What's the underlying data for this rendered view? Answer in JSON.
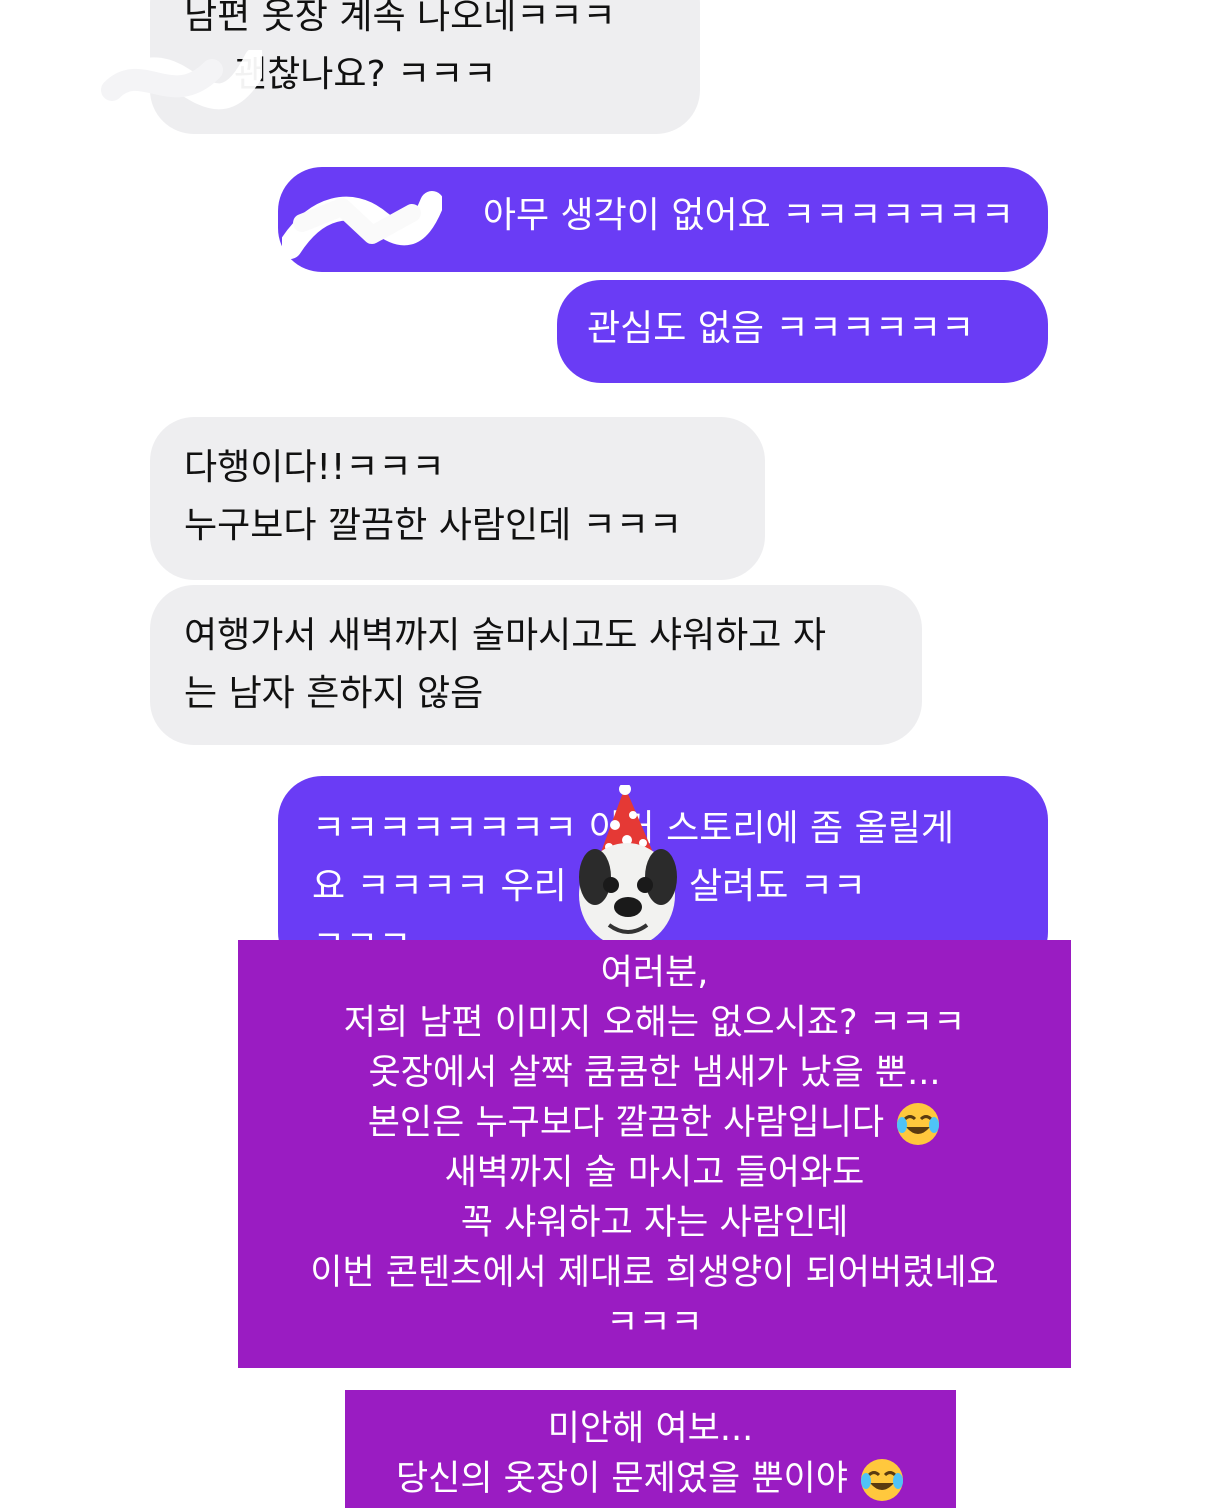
{
  "messages": [
    {
      "id": "b1",
      "side": "received",
      "lines": [
        "남편 옷장 계속 나오네ㅋㅋㅋ",
        "괜찮나요? ㅋㅋㅋ"
      ]
    },
    {
      "id": "b2",
      "side": "sent",
      "lines": [
        "아무 생각이 없어요 ㅋㅋㅋㅋㅋㅋㅋ"
      ]
    },
    {
      "id": "b3",
      "side": "sent",
      "lines": [
        "관심도 없음 ㅋㅋㅋㅋㅋㅋ"
      ]
    },
    {
      "id": "b4",
      "side": "received",
      "lines": [
        "다행이다!!ㅋㅋㅋ",
        "누구보다 깔끔한 사람인데 ㅋㅋㅋ"
      ]
    },
    {
      "id": "b5",
      "side": "received",
      "lines": [
        "여행가서 새벽까지 술마시고도 샤워하고 자",
        "는 남자 흔하지 않음"
      ]
    },
    {
      "id": "b6",
      "side": "sent",
      "lines": [
        "ㅋㅋㅋㅋㅋㅋㅋㅋ 이거 스토리에 좀 올릴게",
        "요 ㅋㅋㅋㅋ 우리 이미지 살려됴 ㅋㅋ",
        "ㅋㅋㅋ"
      ]
    }
  ],
  "story_overlay": {
    "lines": [
      "여러분,",
      "저희 남편 이미지 오해는 없으시죠? ㅋㅋㅋ",
      "옷장에서 살짝 쿰쿰한 냄새가 났을 뿐...",
      "본인은 누구보다 깔끔한 사람입니다",
      "새벽까지 술 마시고 들어와도",
      "꼭 샤워하고 자는 사람인데",
      "이번 콘텐츠에서 제대로 희생양이 되어버렸네요",
      "ㅋㅋㅋ"
    ],
    "closing_lines": [
      "미안해 여보...",
      "당신의 옷장이 문제였을 뿐이야"
    ]
  },
  "icons": {
    "laugh_emoji": "face-with-tears-of-joy-icon",
    "sticker": "party-dog-sticker"
  },
  "colors": {
    "sent_bubble": "#6a3cf5",
    "received_bubble": "#eeeef0",
    "story_box": "#9a1cc2"
  }
}
